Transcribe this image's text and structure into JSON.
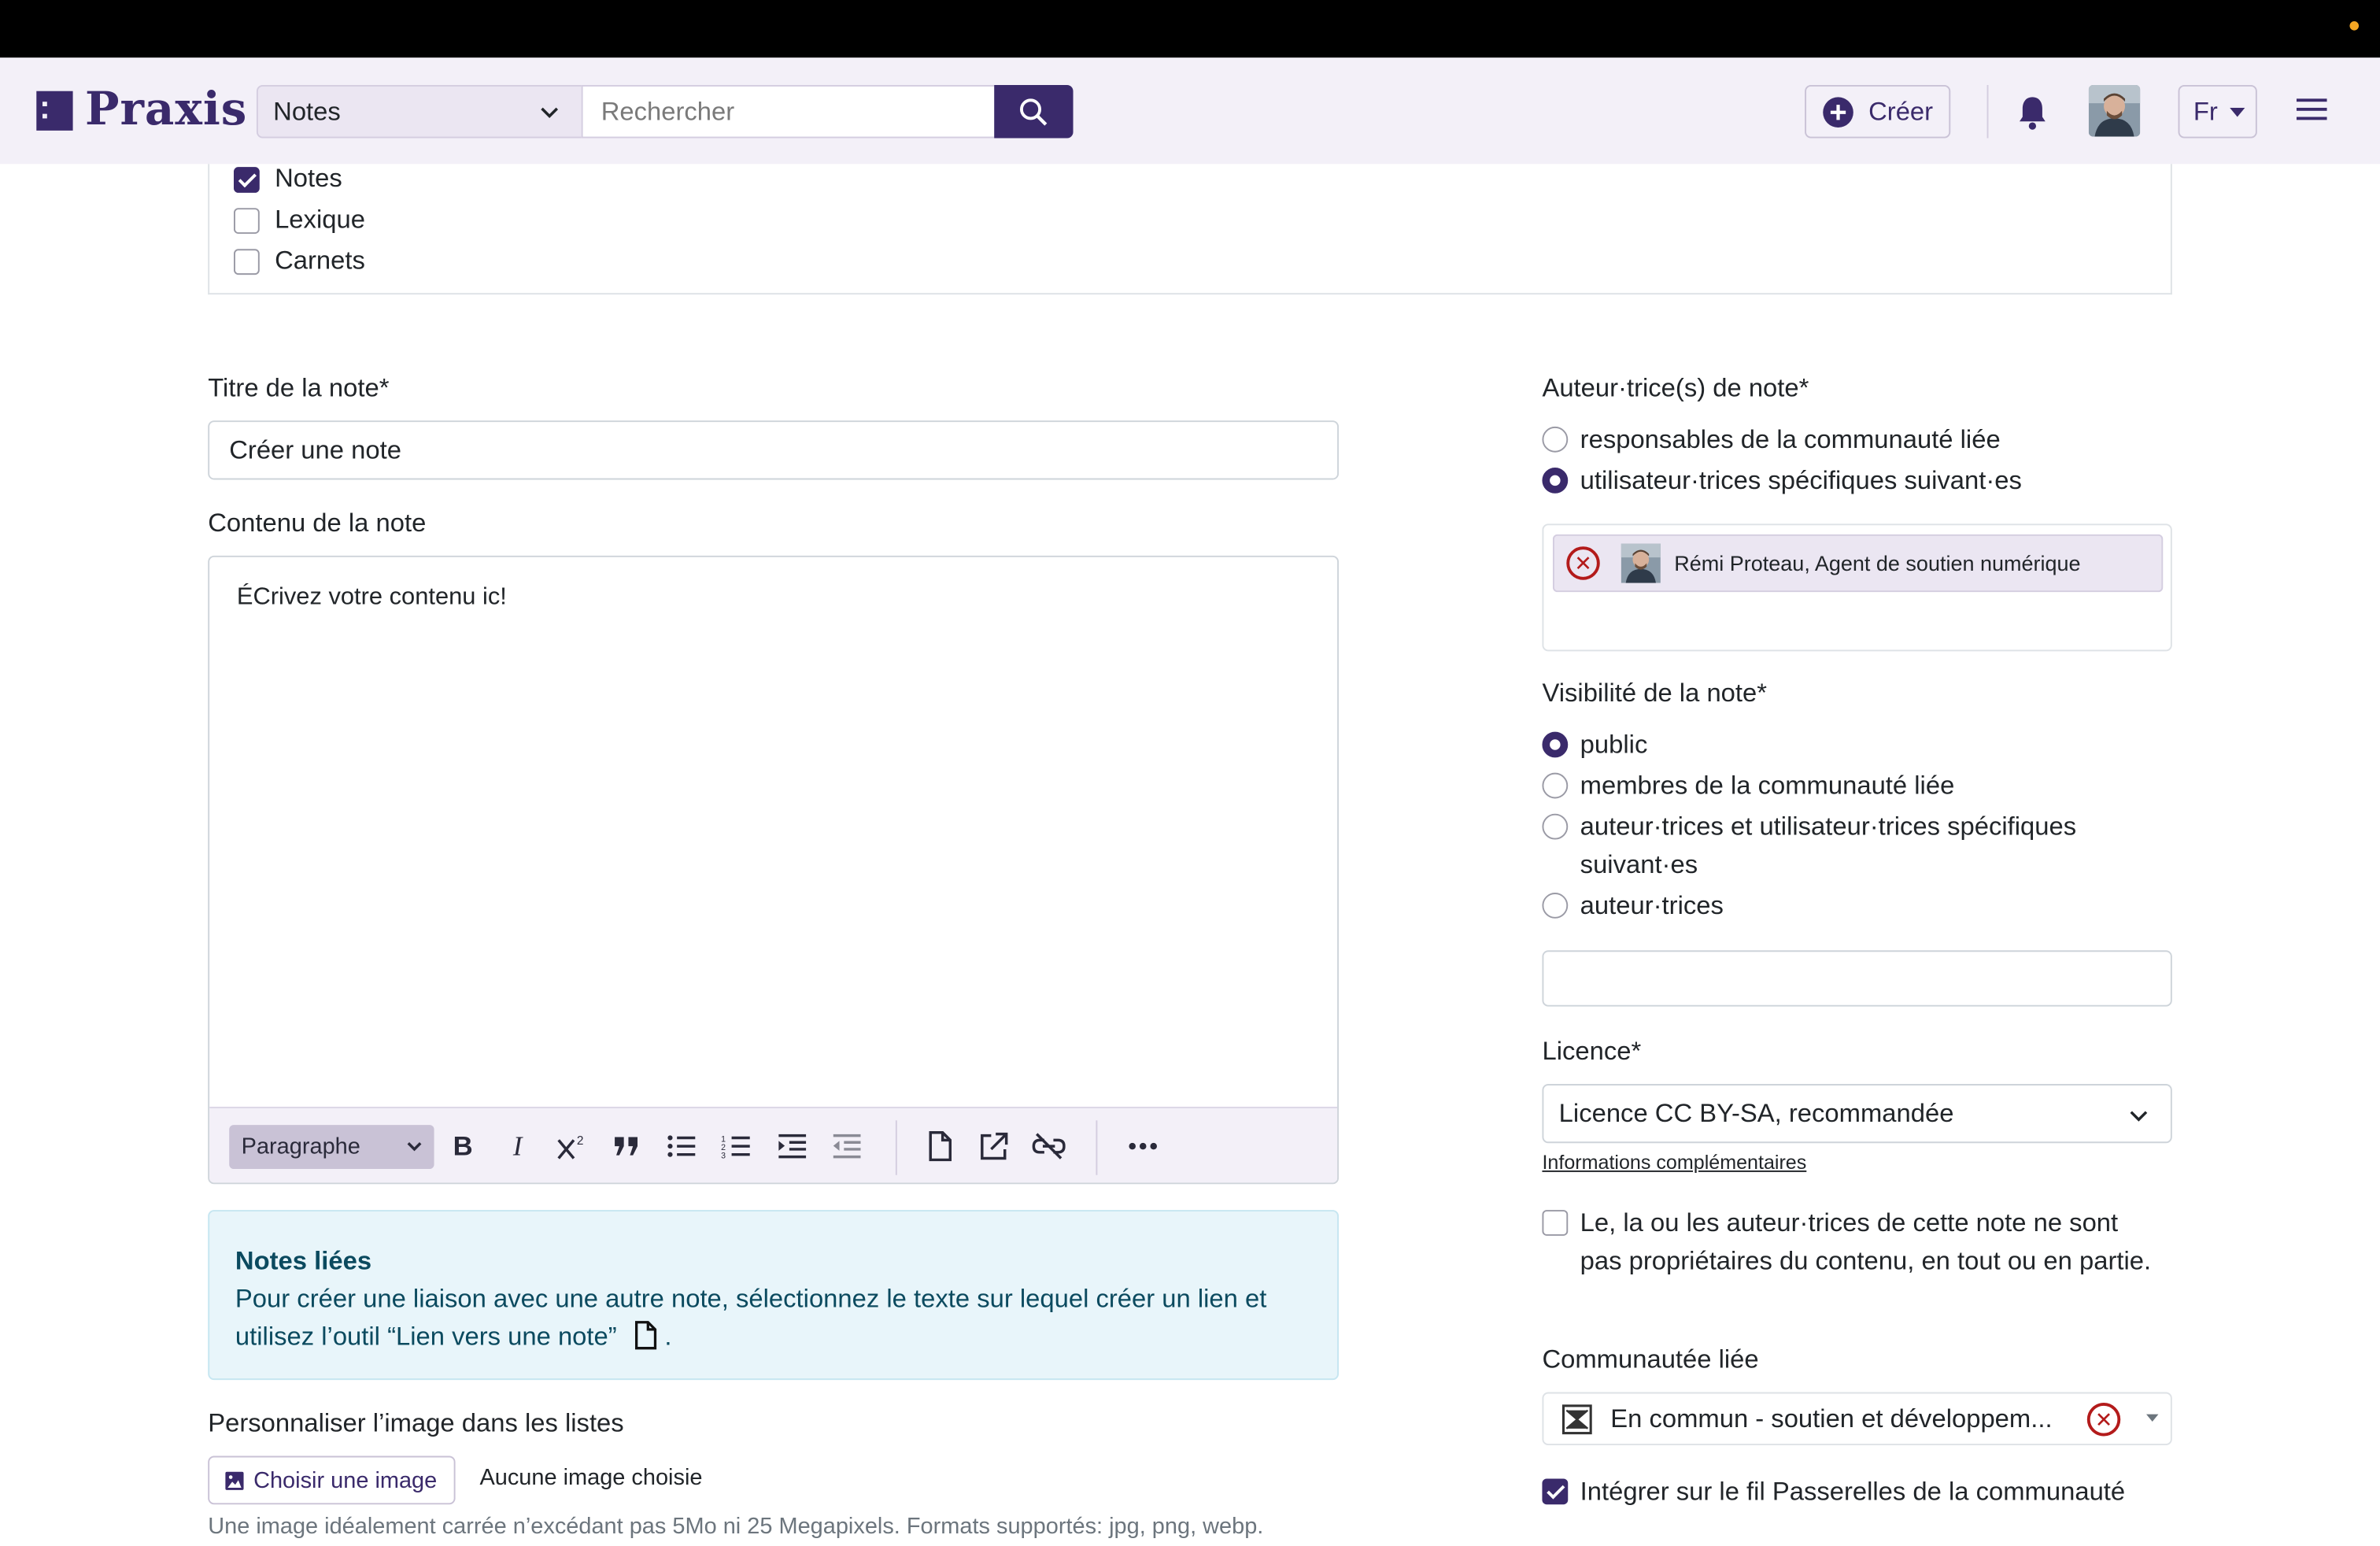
{
  "navbar": {
    "brand": "Praxis",
    "scope_selected": "Notes",
    "search_placeholder": "Rechercher",
    "create_label": "Créer",
    "lang": "Fr"
  },
  "filters": {
    "items": [
      {
        "label": "Notes",
        "checked": true
      },
      {
        "label": "Lexique",
        "checked": false
      },
      {
        "label": "Carnets",
        "checked": false
      }
    ]
  },
  "form": {
    "title_label": "Titre de la note*",
    "title_value": "Créer une note",
    "content_label": "Contenu de la note",
    "content_value": "ÉCrivez votre contenu ic!",
    "paragraph_select": "Paragraphe",
    "alert_title": "Notes liées",
    "alert_body": "Pour créer une liaison avec une autre note, sélectionnez le texte sur lequel créer un lien et utilisez l’outil “Lien vers une note”",
    "alert_end": ".",
    "image_label": "Personnaliser l’image dans les listes",
    "image_button": "Choisir une image",
    "image_none": "Aucune image choisie",
    "image_help": "Une image idéalement carrée n’excédant pas 5Mo ni 25 Megapixels. Formats supportés: jpg, png, webp."
  },
  "side": {
    "authors_label": "Auteur·trice(s) de note*",
    "authors_options": [
      {
        "label": "responsables de la communauté liée",
        "selected": false
      },
      {
        "label": "utilisateur·trices spécifiques suivant·es",
        "selected": true
      }
    ],
    "author_chip": "Rémi Proteau, Agent de soutien numérique",
    "visibility_label": "Visibilité de la note*",
    "visibility_options": [
      {
        "label": "public",
        "selected": true
      },
      {
        "label": "membres de la communauté liée",
        "selected": false
      },
      {
        "label": "auteur·trices et utilisateur·trices spécifiques suivant·es",
        "selected": false
      },
      {
        "label": "auteur·trices",
        "selected": false
      }
    ],
    "licence_label": "Licence*",
    "licence_value": "Licence CC BY-SA, recommandée",
    "licence_link": "Informations complémentaires",
    "ownership_text": "Le, la ou les auteur·trices de cette note ne sont pas propriétaires du contenu, en tout ou en partie.",
    "community_label": "Communautée liée",
    "community_value": "En commun - soutien et développem...",
    "integrate_label": "Intégrer sur le fil Passerelles de la communauté"
  },
  "colors": {
    "brand": "#3a2a6b",
    "nav_bg": "#f3f0f8",
    "alert_bg": "#e8f5fa",
    "remove_red": "#b31b1b"
  }
}
